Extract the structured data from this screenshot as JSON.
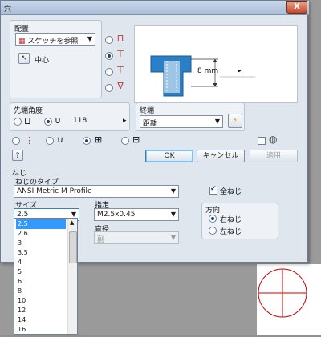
{
  "window": {
    "title": "穴",
    "close_label": "X"
  },
  "placement": {
    "group_label": "配置",
    "mode_select": "スケッチを参照",
    "center_label": "中心",
    "depth_label": "8 mm"
  },
  "drill_point": {
    "group_label": "先端角度",
    "angle_value": "118",
    "angle_arrow": "▸"
  },
  "termination": {
    "group_label": "終端",
    "value": "距離"
  },
  "buttons": {
    "ok": "OK",
    "cancel": "キャンセル",
    "apply": "適用",
    "help": "?"
  },
  "threads": {
    "section_label": "ねじ",
    "type_label": "ねじのタイプ",
    "type_value": "ANSI Metric M Profile",
    "full_thread_label": "全ねじ",
    "size_label": "サイズ",
    "size_value": "2.5",
    "designation_label": "指定",
    "designation_value": "M2.5x0.45",
    "diameter_label": "直径",
    "diameter_value": "副",
    "direction_label": "方向",
    "right_hand": "右ねじ",
    "left_hand": "左ねじ"
  },
  "size_options": [
    "2.5",
    "2.6",
    "3",
    "3.5",
    "4",
    "5",
    "6",
    "8",
    "10",
    "12",
    "14",
    "16"
  ],
  "colors": {
    "accent": "#3399ff",
    "red": "#cc0000"
  }
}
